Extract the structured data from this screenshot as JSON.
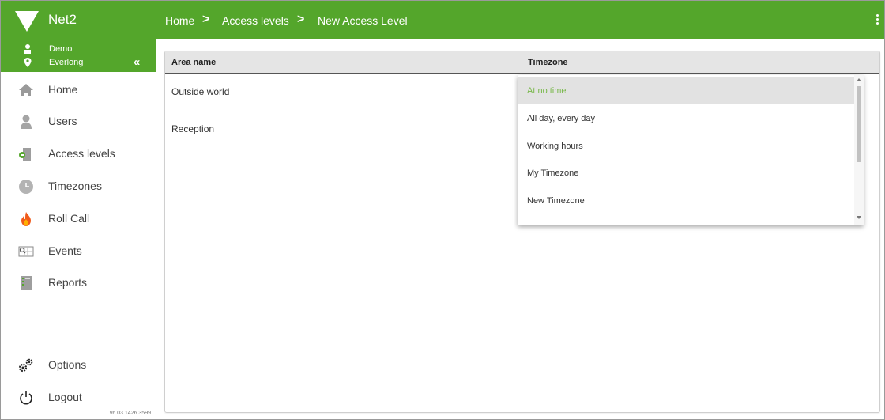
{
  "app": {
    "name": "Net2"
  },
  "user": {
    "name": "Demo",
    "site": "Everlong",
    "collapse_glyph": "«"
  },
  "sidebar": {
    "items": [
      {
        "label": "Home",
        "icon": "home-icon"
      },
      {
        "label": "Users",
        "icon": "user-icon"
      },
      {
        "label": "Access levels",
        "icon": "door-icon"
      },
      {
        "label": "Timezones",
        "icon": "clock-icon"
      },
      {
        "label": "Roll Call",
        "icon": "fire-icon"
      },
      {
        "label": "Events",
        "icon": "events-icon"
      },
      {
        "label": "Reports",
        "icon": "report-icon"
      }
    ],
    "bottom_items": [
      {
        "label": "Options",
        "icon": "gears-icon"
      },
      {
        "label": "Logout",
        "icon": "power-icon"
      }
    ],
    "version": "v6.03.1426.3599"
  },
  "breadcrumb": {
    "items": [
      "Home",
      "Access levels",
      "New Access Level"
    ],
    "separator": ">"
  },
  "table": {
    "columns": [
      "Area name",
      "Timezone"
    ],
    "rows": [
      {
        "area": "Outside world"
      },
      {
        "area": "Reception"
      }
    ]
  },
  "dropdown": {
    "options": [
      "At no time",
      "All day, every day",
      "Working hours",
      "My Timezone",
      "New Timezone"
    ],
    "selected": "At no time"
  },
  "colors": {
    "brand": "#54a62b",
    "selected_text": "#78b84a"
  }
}
